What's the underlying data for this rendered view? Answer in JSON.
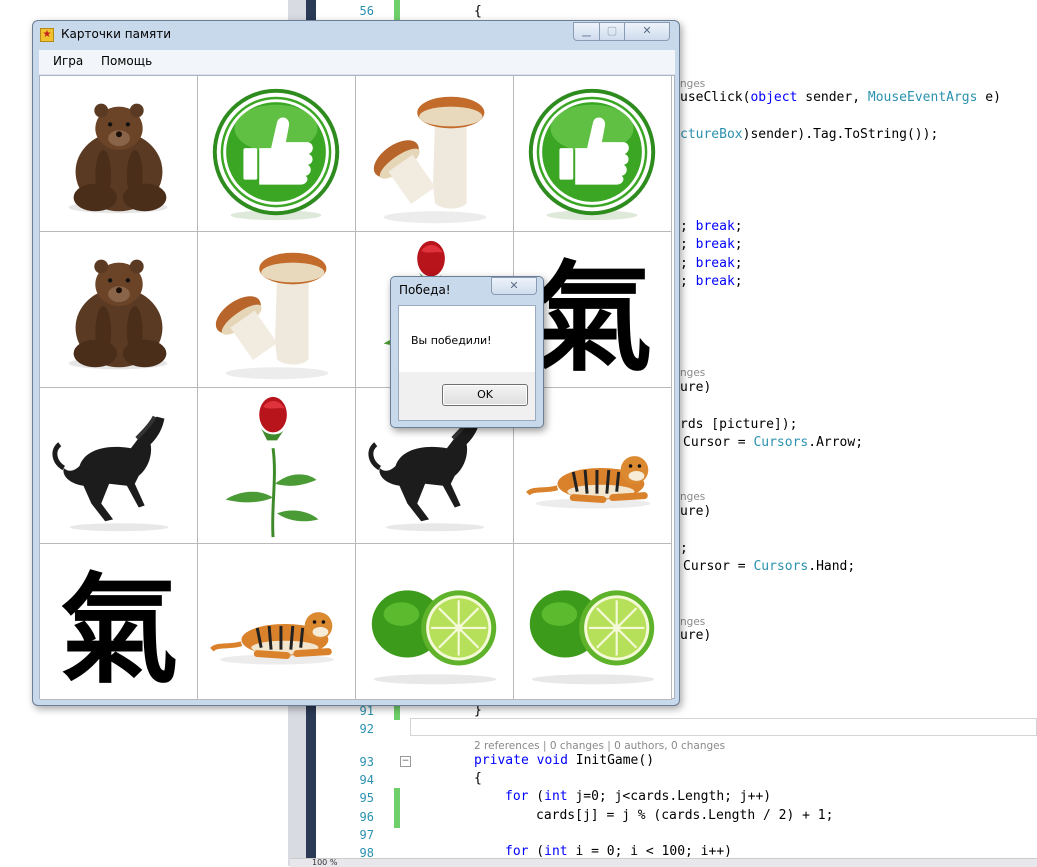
{
  "editor": {
    "line_numbers": [
      "56",
      "91",
      "92",
      "93",
      "94",
      "95",
      "96",
      "97",
      "98"
    ],
    "code": {
      "brace_56": "{",
      "frag_a": "nges",
      "frag_b_name": "useClick(",
      "frag_b_kw": "object",
      "frag_b_mid": " sender, ",
      "frag_b_type": "MouseEventArgs",
      "frag_b_end": " e)",
      "frag_c_type": "ctureBox",
      "frag_c_end": ")sender).Tag.ToString());",
      "break_prefix": "; ",
      "break_kw": "break",
      "break_end": ";",
      "frag_d_meta": "nges",
      "frag_d": "ure)",
      "frag_e": "rds [picture]);",
      "frag_f_start": "Cursor = ",
      "frag_f_type": "Cursors",
      "frag_f_end": ".Arrow;",
      "frag_g_meta": "nges",
      "frag_g": "ure)",
      "frag_h": ";",
      "frag_i_start": "Cursor = ",
      "frag_i_type": "Cursors",
      "frag_i_end": ".Hand;",
      "frag_j_meta": "nges",
      "frag_j": "ure)",
      "brace_91": "}",
      "refs_meta": "2 references | 0 changes | 0 authors, 0 changes",
      "l93_kw1": "private",
      "l93_kw2": "void",
      "l93_rest": " InitGame()",
      "brace_94": "{",
      "l95_kw": "for",
      "l95_a": " (",
      "l95_kw2": "int",
      "l95_b": " j=0; j<cards.Length; j++)",
      "l96": "cards[j] = j % (cards.Length / 2) + 1;",
      "l98_kw": "for",
      "l98_a": " (",
      "l98_kw2": "int",
      "l98_b": " i = 0; i < 100; i++)"
    },
    "zoom": "100 %"
  },
  "window": {
    "title": "Карточки памяти",
    "menu": [
      "Игра",
      "Помощь"
    ],
    "cards": [
      {
        "name": "bear-card",
        "image": "bear"
      },
      {
        "name": "thumbs-up-card",
        "image": "thumbs-up"
      },
      {
        "name": "mushroom-card",
        "image": "mushroom"
      },
      {
        "name": "thumbs-up-card",
        "image": "thumbs-up"
      },
      {
        "name": "bear-card",
        "image": "bear"
      },
      {
        "name": "mushroom-card",
        "image": "mushroom"
      },
      {
        "name": "rose-card",
        "image": "rose"
      },
      {
        "name": "qi-character-card",
        "image": "qi-character"
      },
      {
        "name": "horse-card",
        "image": "horse"
      },
      {
        "name": "rose-card",
        "image": "rose"
      },
      {
        "name": "horse-card",
        "image": "horse"
      },
      {
        "name": "tiger-card",
        "image": "tiger"
      },
      {
        "name": "qi-character-card",
        "image": "qi-character"
      },
      {
        "name": "tiger-card",
        "image": "tiger"
      },
      {
        "name": "lime-card",
        "image": "lime"
      },
      {
        "name": "lime-card",
        "image": "lime"
      }
    ],
    "qi_glyph": "氣"
  },
  "dialog": {
    "title": "Победа!",
    "message": "Вы победили!",
    "ok_label": "OK"
  },
  "colors": {
    "window_frame": "#c9d9ec",
    "green_mark": "#6fcf6a",
    "keyword": "#0000ff",
    "type": "#2b91af"
  }
}
